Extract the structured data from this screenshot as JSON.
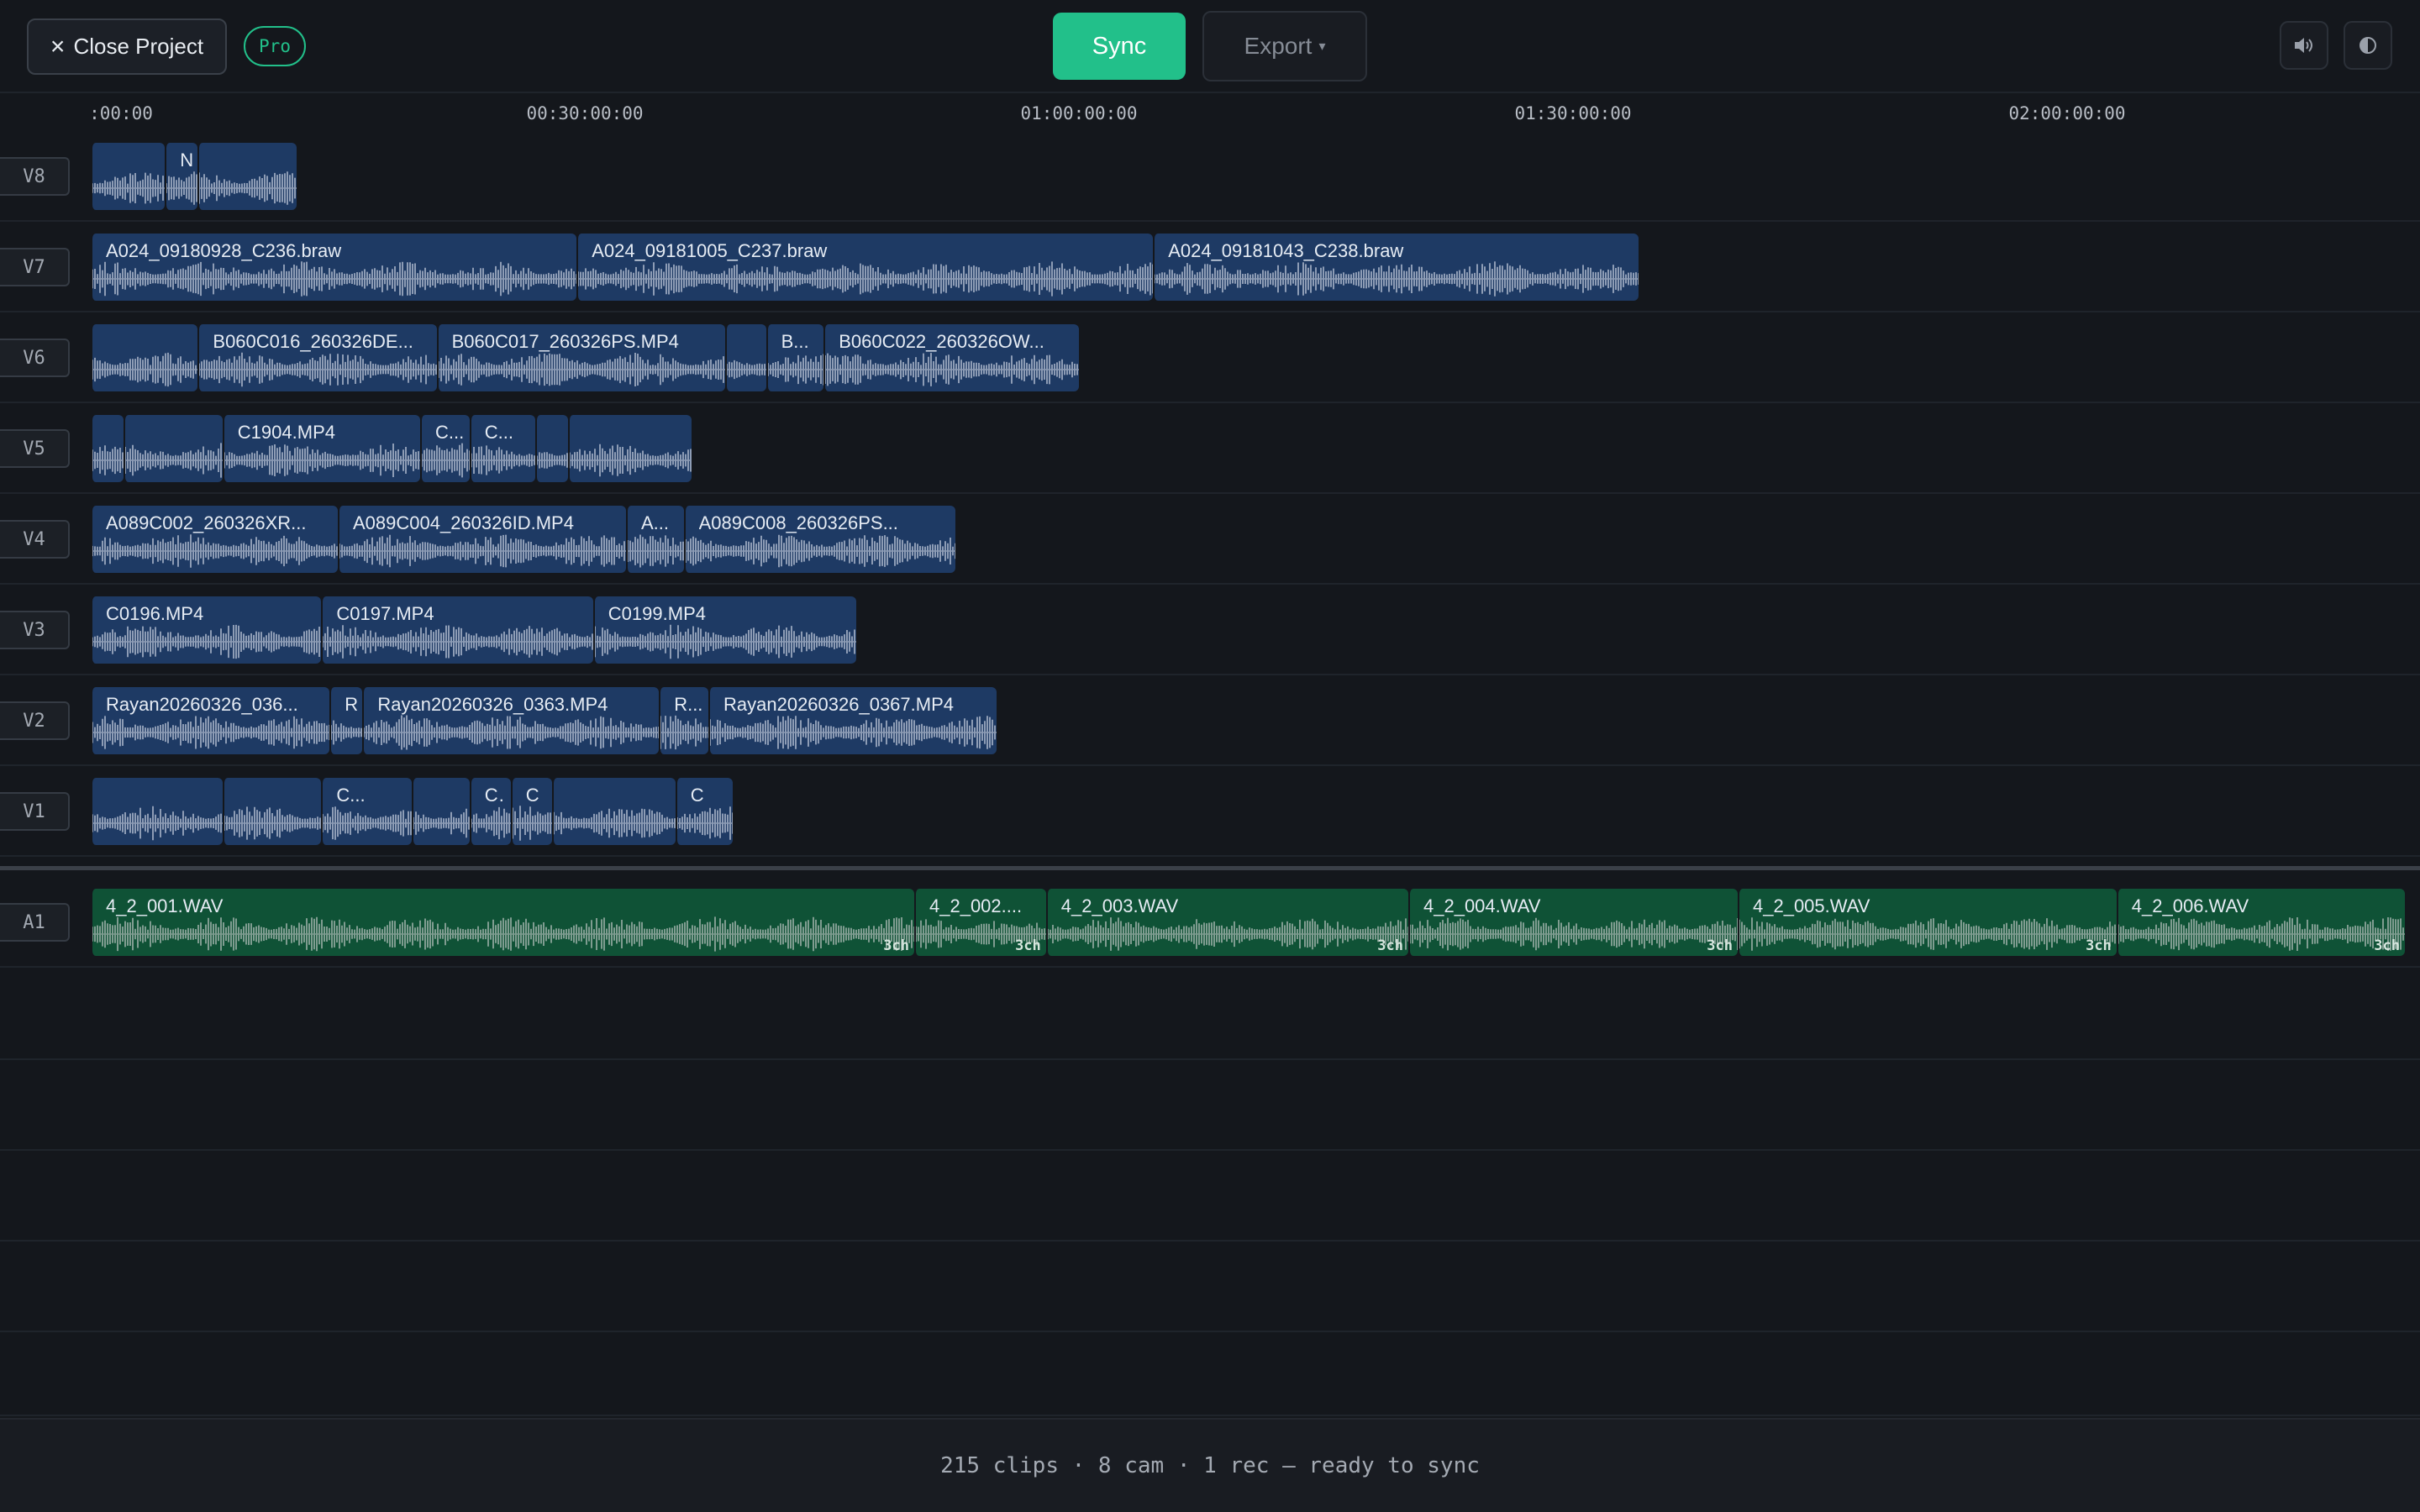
{
  "toolbar": {
    "close_label": "Close Project",
    "pro_badge": "Pro",
    "sync_label": "Sync",
    "export_label": "Export",
    "volume_icon": "speaker-icon",
    "theme_icon": "contrast-icon"
  },
  "ruler": {
    "ticks": [
      ":00:00",
      "00:30:00:00",
      "01:00:00:00",
      "01:30:00:00",
      "02:00:00:00"
    ]
  },
  "colors": {
    "accent": "#22c08a",
    "video_clip": "#1e3a64",
    "audio_clip": "#0f5236",
    "background": "#14171c"
  },
  "tracks": [
    {
      "name": "V8",
      "kind": "video",
      "clips": [
        {
          "label": "",
          "start": 0,
          "end": 0.09
        },
        {
          "label": "N",
          "start": 0.09,
          "end": 0.13
        },
        {
          "label": "",
          "start": 0.13,
          "end": 0.25
        }
      ]
    },
    {
      "name": "V7",
      "kind": "video",
      "clips": [
        {
          "label": "A024_09180928_C236.braw",
          "start": 0,
          "end": 0.59
        },
        {
          "label": "A024_09181005_C237.braw",
          "start": 0.59,
          "end": 1.29
        },
        {
          "label": "A024_09181043_C238.braw",
          "start": 1.29,
          "end": 1.88
        }
      ]
    },
    {
      "name": "V6",
      "kind": "video",
      "clips": [
        {
          "label": "",
          "start": 0,
          "end": 0.13
        },
        {
          "label": "B060C016_260326DE...",
          "start": 0.13,
          "end": 0.42
        },
        {
          "label": "B060C017_260326PS.MP4",
          "start": 0.42,
          "end": 0.77
        },
        {
          "label": "",
          "start": 0.77,
          "end": 0.82
        },
        {
          "label": "B...",
          "start": 0.82,
          "end": 0.89
        },
        {
          "label": "B060C022_260326OW...",
          "start": 0.89,
          "end": 1.2
        }
      ]
    },
    {
      "name": "V5",
      "kind": "video",
      "clips": [
        {
          "label": "",
          "start": 0,
          "end": 0.04
        },
        {
          "label": "",
          "start": 0.04,
          "end": 0.16
        },
        {
          "label": "C1904.MP4",
          "start": 0.16,
          "end": 0.4
        },
        {
          "label": "C...",
          "start": 0.4,
          "end": 0.46
        },
        {
          "label": "C...",
          "start": 0.46,
          "end": 0.54
        },
        {
          "label": "",
          "start": 0.54,
          "end": 0.58
        },
        {
          "label": "",
          "start": 0.58,
          "end": 0.73
        }
      ]
    },
    {
      "name": "V4",
      "kind": "video",
      "clips": [
        {
          "label": "A089C002_260326XR...",
          "start": 0,
          "end": 0.3
        },
        {
          "label": "A089C004_260326ID.MP4",
          "start": 0.3,
          "end": 0.65
        },
        {
          "label": "A...",
          "start": 0.65,
          "end": 0.72
        },
        {
          "label": "A089C008_260326PS...",
          "start": 0.72,
          "end": 1.05
        }
      ]
    },
    {
      "name": "V3",
      "kind": "video",
      "clips": [
        {
          "label": "C0196.MP4",
          "start": 0,
          "end": 0.28
        },
        {
          "label": "C0197.MP4",
          "start": 0.28,
          "end": 0.61
        },
        {
          "label": "C0199.MP4",
          "start": 0.61,
          "end": 0.93
        }
      ]
    },
    {
      "name": "V2",
      "kind": "video",
      "clips": [
        {
          "label": "Rayan20260326_036...",
          "start": 0,
          "end": 0.29
        },
        {
          "label": "R...",
          "start": 0.29,
          "end": 0.33
        },
        {
          "label": "Rayan20260326_0363.MP4",
          "start": 0.33,
          "end": 0.69
        },
        {
          "label": "R...",
          "start": 0.69,
          "end": 0.75
        },
        {
          "label": "Rayan20260326_0367.MP4",
          "start": 0.75,
          "end": 1.1
        }
      ]
    },
    {
      "name": "V1",
      "kind": "video",
      "clips": [
        {
          "label": "",
          "start": 0,
          "end": 0.16
        },
        {
          "label": "",
          "start": 0.16,
          "end": 0.28
        },
        {
          "label": "C...",
          "start": 0.28,
          "end": 0.39
        },
        {
          "label": "",
          "start": 0.39,
          "end": 0.46
        },
        {
          "label": "C...",
          "start": 0.46,
          "end": 0.51
        },
        {
          "label": "C",
          "start": 0.51,
          "end": 0.56
        },
        {
          "label": "",
          "start": 0.56,
          "end": 0.71
        },
        {
          "label": "C",
          "start": 0.71,
          "end": 0.78
        }
      ]
    }
  ],
  "audio_tracks": [
    {
      "name": "A1",
      "kind": "audio",
      "clips": [
        {
          "label": "4_2_001.WAV",
          "channels": "3ch",
          "start": 0,
          "end": 1.0
        },
        {
          "label": "4_2_002....",
          "channels": "3ch",
          "start": 1.0,
          "end": 1.16
        },
        {
          "label": "4_2_003.WAV",
          "channels": "3ch",
          "start": 1.16,
          "end": 1.6
        },
        {
          "label": "4_2_004.WAV",
          "channels": "3ch",
          "start": 1.6,
          "end": 2.0
        },
        {
          "label": "4_2_005.WAV",
          "channels": "3ch",
          "start": 2.0,
          "end": 2.46
        },
        {
          "label": "4_2_006.WAV",
          "channels": "3ch",
          "start": 2.46,
          "end": 2.82
        }
      ]
    }
  ],
  "status": {
    "text": "215 clips · 8 cam · 1 rec — ready to sync"
  }
}
